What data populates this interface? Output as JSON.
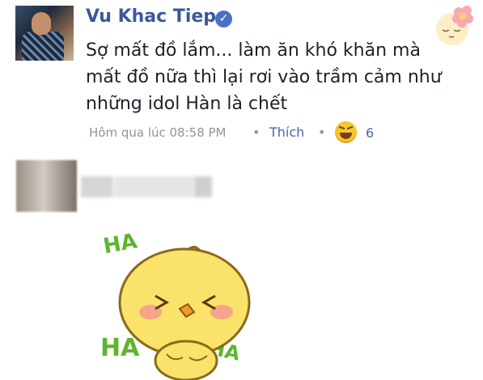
{
  "post": {
    "author": "Vu Khac Tiep",
    "text": "Sợ mất đồ lắm... làm ăn khó khăn mà mất đồ nữa thì lại rơi vào trầm cảm như những idol Hàn là chết",
    "timestamp": "Hôm qua lúc 08:58 PM",
    "dot": "•",
    "like_label": "Thích",
    "reaction_count": "6",
    "verified_glyph": "✓"
  },
  "reaction": {
    "icon": "haha-icon",
    "color": "#f7c531"
  },
  "sticker": {
    "words": [
      "HA",
      "HA",
      "HA"
    ]
  },
  "colors": {
    "name": "#3b5998",
    "link": "#4b67a8",
    "meta": "#8f959e"
  }
}
